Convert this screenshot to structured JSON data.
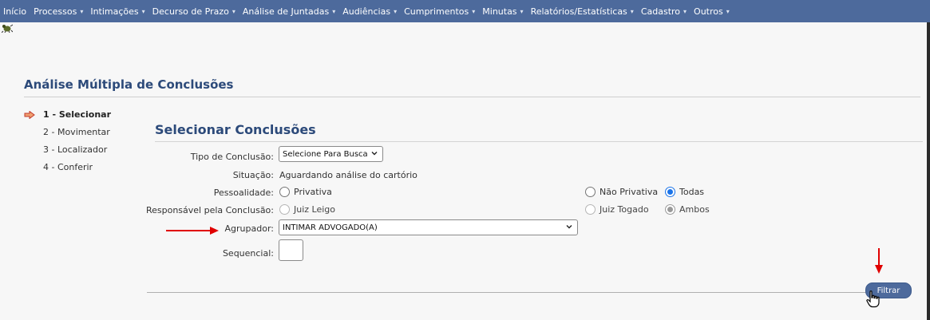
{
  "nav": {
    "items": [
      {
        "label": "Início",
        "caret": false
      },
      {
        "label": "Processos",
        "caret": true
      },
      {
        "label": "Intimações",
        "caret": true
      },
      {
        "label": "Decurso de Prazo",
        "caret": true
      },
      {
        "label": "Análise de Juntadas",
        "caret": true
      },
      {
        "label": "Audiências",
        "caret": true
      },
      {
        "label": "Cumprimentos",
        "caret": true
      },
      {
        "label": "Minutas",
        "caret": true
      },
      {
        "label": "Relatórios/Estatísticas",
        "caret": true
      },
      {
        "label": "Cadastro",
        "caret": true
      },
      {
        "label": "Outros",
        "caret": true
      }
    ],
    "caret_glyph": "▾"
  },
  "page": {
    "title": "Análise Múltipla de Conclusões"
  },
  "steps": [
    {
      "label": "1 - Selecionar",
      "active": true
    },
    {
      "label": "2 - Movimentar",
      "active": false
    },
    {
      "label": "3 - Localizador",
      "active": false
    },
    {
      "label": "4 - Conferir",
      "active": false
    }
  ],
  "form": {
    "section_title": "Selecionar Conclusões",
    "tipo_label": "Tipo de Conclusão:",
    "tipo_value": "Selecione Para Busca",
    "situacao_label": "Situação:",
    "situacao_value": "Aguardando análise do cartório",
    "pessoalidade_label": "Pessoalidade:",
    "pessoalidade_options": [
      {
        "label": "Privativa",
        "checked": false
      },
      {
        "label": "Não Privativa",
        "checked": false
      },
      {
        "label": "Todas",
        "checked": true
      }
    ],
    "responsavel_label": "Responsável pela Conclusão:",
    "responsavel_options": [
      {
        "label": "Juiz Leigo",
        "checked": false,
        "disabled": true
      },
      {
        "label": "Juiz Togado",
        "checked": false,
        "disabled": true
      },
      {
        "label": "Ambos",
        "checked": true,
        "disabled": true
      }
    ],
    "agrupador_label": "Agrupador:",
    "agrupador_value": "INTIMAR ADVOGADO(A)",
    "sequencial_label": "Sequencial:",
    "sequencial_value": "",
    "filter_button": "Filtrar"
  },
  "colors": {
    "nav_bg": "#4d6a9c",
    "title": "#2c4a7a",
    "radio_checked": "#1a73e8",
    "annotation_arrow": "#e00000"
  }
}
